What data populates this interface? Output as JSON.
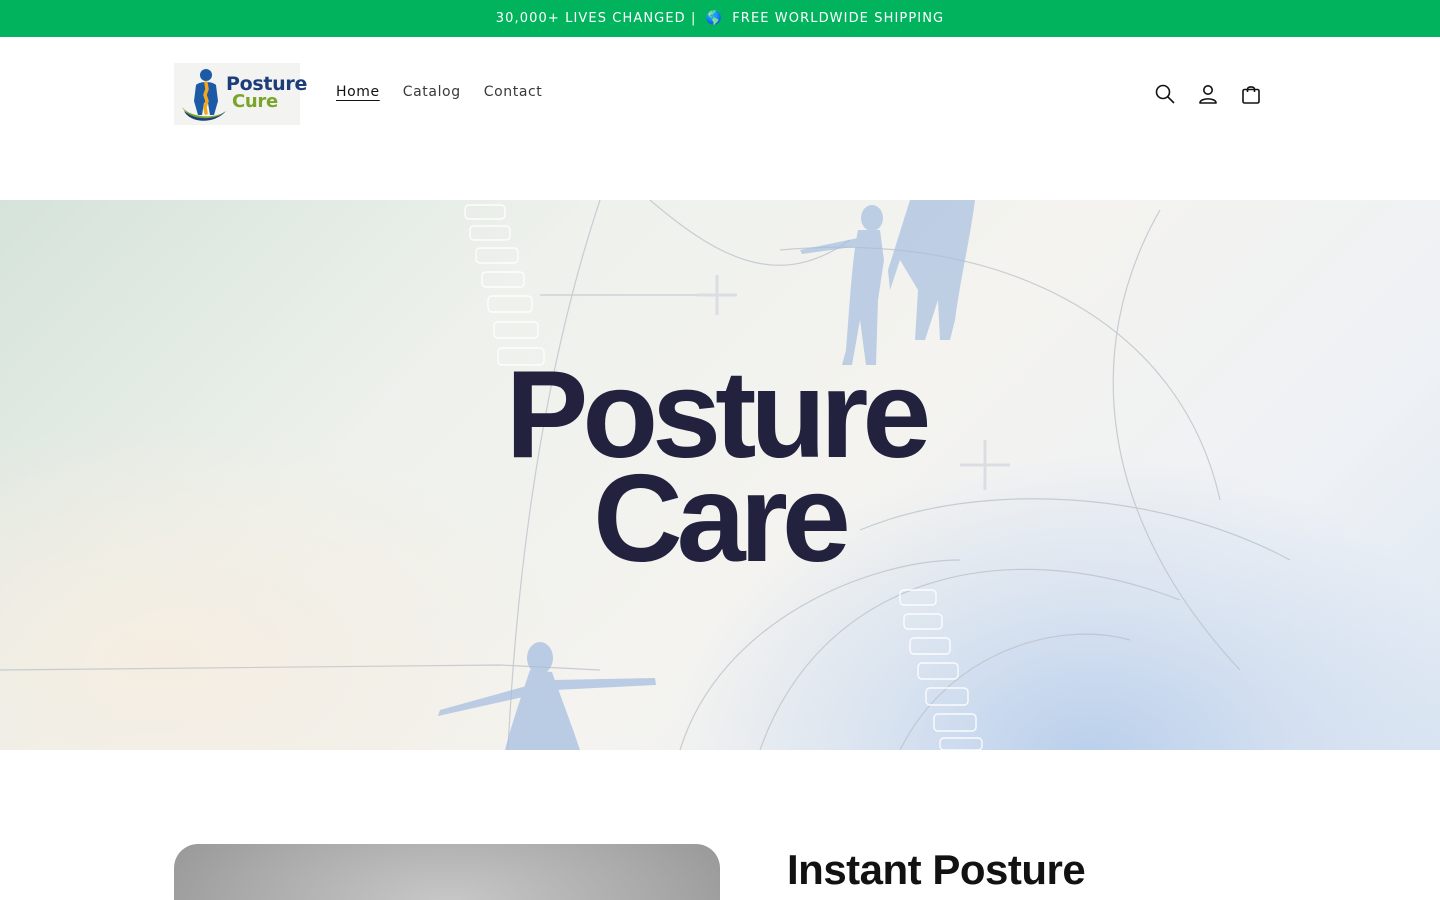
{
  "announcement": {
    "text_before": "30,000+ LIVES CHANGED | ",
    "globe": "🌎",
    "text_after": " FREE WORLDWIDE SHIPPING",
    "background": "#00b35c"
  },
  "header": {
    "logo": {
      "line1": "Posture",
      "line2": "Cure"
    },
    "nav": [
      {
        "label": "Home",
        "active": true
      },
      {
        "label": "Catalog",
        "active": false
      },
      {
        "label": "Contact",
        "active": false
      }
    ],
    "icons": [
      "search-icon",
      "account-icon",
      "cart-icon"
    ]
  },
  "hero": {
    "title_line1": "Posture",
    "title_line2": "Care",
    "title_color": "#22223f"
  },
  "featured": {
    "heading": "Instant Posture"
  }
}
